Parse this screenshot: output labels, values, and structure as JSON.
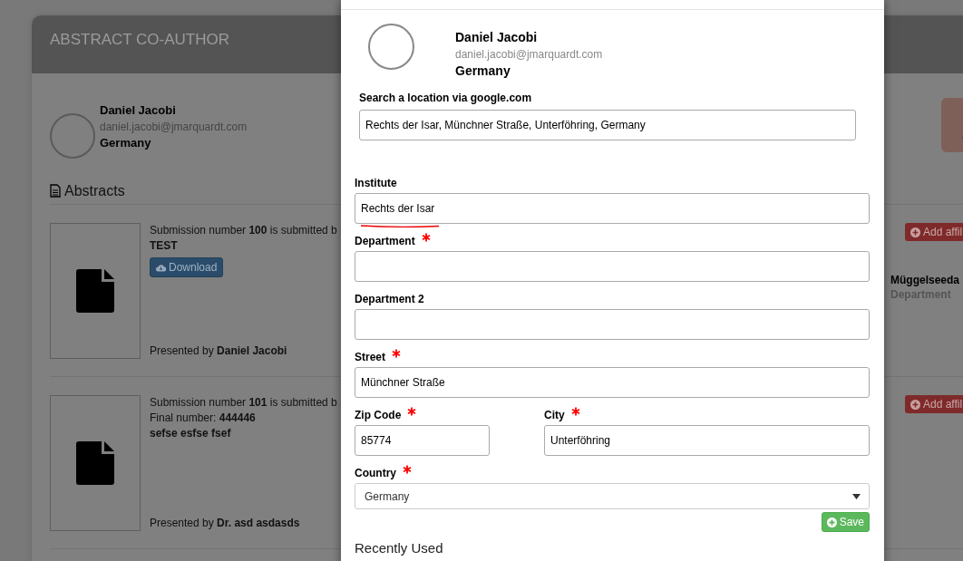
{
  "page": {
    "title": "ABSTRACT CO-AUTHOR",
    "author": {
      "name": "Daniel Jacobi",
      "email": "daniel.jacobi@jmarquardt.com",
      "country": "Germany"
    },
    "section_title": "Abstracts",
    "abstracts": [
      {
        "submission": "Submission number **100** is submitted b",
        "title": "TEST",
        "download": "Download",
        "presented_by": "Presented by **Daniel Jacobi**",
        "affiliation_button": "Add affil",
        "affiliation": {
          "name": "Müggelseeda",
          "department": "Department"
        }
      },
      {
        "submission": "Submission number **101** is submitted b",
        "final_number": "Final number: **444446**",
        "title": "sefse esfse fsef",
        "presented_by": "Presented by **Dr. asd asdasds**",
        "affiliation_button": "Add affil"
      }
    ]
  },
  "modal": {
    "author": {
      "name": "Daniel Jacobi",
      "email": "daniel.jacobi@jmarquardt.com",
      "country": "Germany"
    },
    "search": {
      "label": "Search a location via google.com",
      "value": "Rechts der Isar, Münchner Straße, Unterföhring, Germany"
    },
    "rows": [
      [
        {
          "kind": "text",
          "label": "Institute",
          "required": false,
          "value": "Rechts der Isar",
          "spelling_error": true
        }
      ],
      [
        {
          "kind": "text",
          "label": "Department",
          "required": true,
          "spelling_error": false
        }
      ],
      [
        {
          "kind": "text",
          "label": "Department 2",
          "required": false,
          "spelling_error": false
        }
      ],
      [
        {
          "kind": "text",
          "label": "Street",
          "required": true,
          "value": "Münchner Straße",
          "spelling_error": false
        }
      ],
      [
        {
          "kind": "text",
          "label": "Zip Code",
          "required": true,
          "value": "85774",
          "spelling_error": false
        },
        {
          "kind": "text",
          "label": "City",
          "required": true,
          "value": "Unterföhring",
          "spelling_error": false
        }
      ],
      [
        {
          "kind": "select",
          "label": "Country",
          "required": true,
          "value": "Germany",
          "spelling_error": false
        }
      ]
    ],
    "save": "Save",
    "recent_title": "Recently Used"
  }
}
